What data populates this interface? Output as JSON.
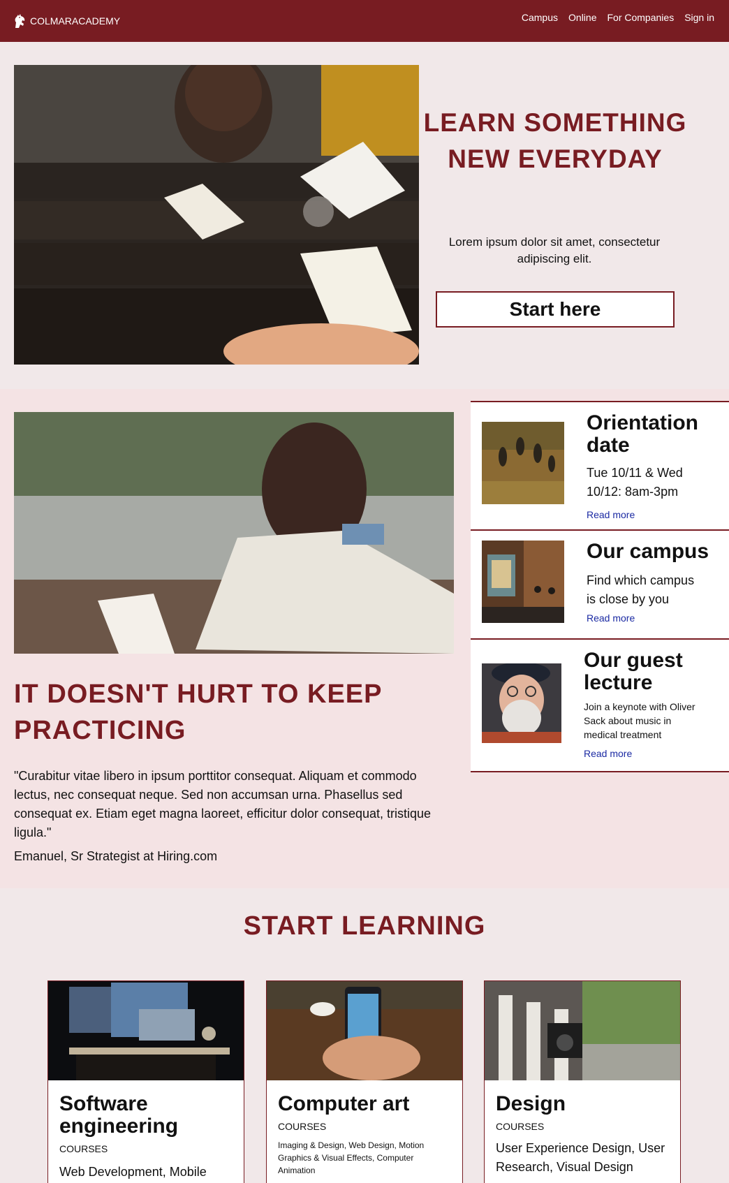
{
  "nav": {
    "brand": "COLMARACADEMY",
    "links": [
      "Campus",
      "Online",
      "For Companies",
      "Sign in"
    ]
  },
  "hero": {
    "title": "Learn Something New Everyday",
    "text": "Lorem ipsum dolor sit amet, consectetur adipiscing elit.",
    "button": "Start here"
  },
  "practice": {
    "title": "It doesn't hurt to keep practicing",
    "quote": "\"Curabitur vitae libero in ipsum porttitor consequat. Aliquam et commodo lectus, nec consequat neque. Sed non accumsan urna. Phasellus sed consequat ex. Etiam eget magna laoreet, efficitur dolor consequat, tristique ligula.\"",
    "author": "Emanuel, Sr Strategist at Hiring.com"
  },
  "events": [
    {
      "title": "Orientation date",
      "description": "Tue 10/11 & Wed 10/12: 8am-3pm",
      "link": "Read more"
    },
    {
      "title": "Our campus",
      "description": "Find which campus is close by you",
      "link": "Read more"
    },
    {
      "title": "Our guest lecture",
      "description": "Join a keynote with Oliver Sack about music in medical treatment",
      "link": "Read more"
    }
  ],
  "learning": {
    "title": "Start learning",
    "courses": [
      {
        "title": "Software engineering",
        "label": "Courses",
        "topics": "Web Development, Mobile"
      },
      {
        "title": "Computer art",
        "label": "Courses",
        "topics": "Imaging & Design, Web Design, Motion Graphics & Visual Effects, Computer Animation"
      },
      {
        "title": "Design",
        "label": "Courses",
        "topics": "User Experience Design, User Research, Visual Design"
      }
    ]
  },
  "colors": {
    "brand": "#781c22",
    "link": "#1b2aa3",
    "section_bg": "#f4e3e4"
  },
  "icons": [
    "horse-logo-icon"
  ]
}
